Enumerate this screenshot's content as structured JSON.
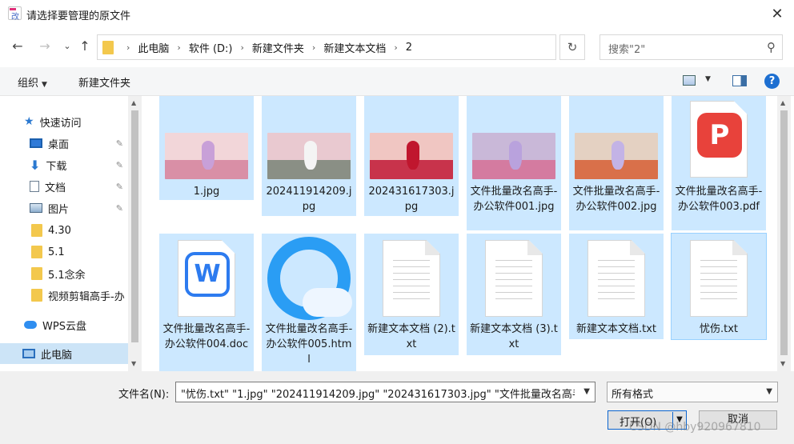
{
  "window": {
    "title": "请选择要管理的原文件",
    "close_glyph": "✕"
  },
  "nav": {
    "back_glyph": "←",
    "forward_glyph": "→",
    "recent_glyph": "⌄",
    "up_glyph": "↑",
    "refresh_glyph": "↻"
  },
  "address": {
    "crumbs": [
      "此电脑",
      "软件 (D:)",
      "新建文件夹",
      "新建文本文档",
      "2"
    ],
    "separator": "›"
  },
  "search": {
    "placeholder": "搜索\"2\"",
    "icon": "search-icon"
  },
  "toolbar": {
    "organize_label": "组织",
    "new_folder_label": "新建文件夹",
    "help_label": "?"
  },
  "sidebar": {
    "items": [
      {
        "label": "快速访问",
        "icon": "star-icon"
      },
      {
        "label": "桌面",
        "icon": "desktop-icon",
        "pinned": true
      },
      {
        "label": "下载",
        "icon": "download-icon",
        "pinned": true
      },
      {
        "label": "文档",
        "icon": "document-icon",
        "pinned": true
      },
      {
        "label": "图片",
        "icon": "pictures-icon",
        "pinned": true
      },
      {
        "label": "4.30",
        "icon": "folder-icon"
      },
      {
        "label": "5.1",
        "icon": "folder-icon"
      },
      {
        "label": "5.1念余",
        "icon": "folder-icon"
      },
      {
        "label": "视频剪辑高手-办",
        "icon": "folder-icon"
      },
      {
        "label": "WPS云盘",
        "icon": "cloud-icon"
      },
      {
        "label": "此电脑",
        "icon": "computer-icon",
        "selected": true
      }
    ],
    "pin_glyph": "📌"
  },
  "files": [
    {
      "name": "1.jpg",
      "type": "photo",
      "selected": true,
      "sky": "#f2d6d9",
      "ground": "#d98fa6",
      "figure": "#c8a0d8"
    },
    {
      "name": "202411914209.jpg",
      "type": "photo",
      "selected": true,
      "sky": "#e9c9d0",
      "ground": "#8a8f85",
      "figure": "#f4f4f4"
    },
    {
      "name": "202431617303.jpg",
      "type": "photo",
      "selected": true,
      "sky": "#f0c6c2",
      "ground": "#c8334b",
      "figure": "#c0162e"
    },
    {
      "name": "文件批量改名高手-办公软件001.jpg",
      "type": "photo",
      "selected": true,
      "sky": "#c9b8d8",
      "ground": "#d47ba0",
      "figure": "#b9a2dd"
    },
    {
      "name": "文件批量改名高手-办公软件002.jpg",
      "type": "photo",
      "selected": true,
      "sky": "#e4d1c2",
      "ground": "#d9704a",
      "figure": "#c3b3e6"
    },
    {
      "name": "文件批量改名高手-办公软件003.pdf",
      "type": "pdf",
      "selected": true,
      "badge": "P"
    },
    {
      "name": "文件批量改名高手-办公软件004.doc",
      "type": "word",
      "selected": true,
      "badge": "W"
    },
    {
      "name": "文件批量改名高手-办公软件005.html",
      "type": "browser",
      "selected": true
    },
    {
      "name": "新建文本文档 (2).txt",
      "type": "text",
      "selected": true
    },
    {
      "name": "新建文本文档 (3).txt",
      "type": "text",
      "selected": true
    },
    {
      "name": "新建文本文档.txt",
      "type": "text",
      "selected": true
    },
    {
      "name": "忧伤.txt",
      "type": "text",
      "selected": true
    }
  ],
  "footer": {
    "filename_label": "文件名(N):",
    "filename_value": "\"忧伤.txt\" \"1.jpg\" \"202411914209.jpg\" \"202431617303.jpg\" \"文件批量改名高手",
    "filter_value": "所有格式",
    "open_label": "打开(O)",
    "cancel_label": "取消"
  },
  "watermark": "CSDN @hby920967810",
  "colors": {
    "selection": "#cce8ff",
    "accent": "#0a64cf"
  }
}
